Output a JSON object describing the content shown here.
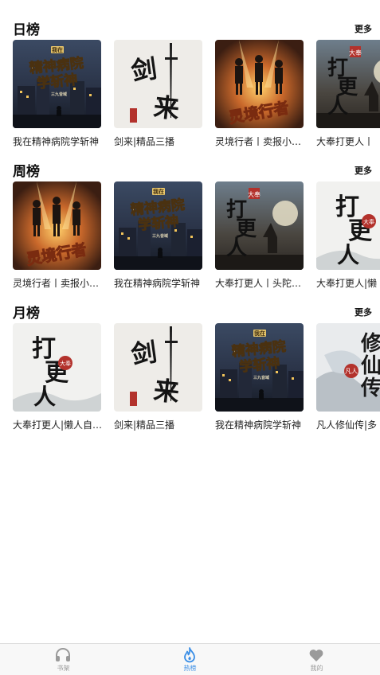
{
  "sections": [
    {
      "title": "日榜",
      "more": "更多",
      "books": [
        {
          "title": "我在精神病院学斩神",
          "cover": "jingshen"
        },
        {
          "title": "剑来|精品三播",
          "cover": "jianlai"
        },
        {
          "title": "灵境行者丨卖报小…",
          "cover": "lingjing"
        },
        {
          "title": "大奉打更人丨",
          "cover": "dafeng-dark"
        }
      ]
    },
    {
      "title": "周榜",
      "more": "更多",
      "books": [
        {
          "title": "灵境行者丨卖报小…",
          "cover": "lingjing"
        },
        {
          "title": "我在精神病院学斩神",
          "cover": "jingshen"
        },
        {
          "title": "大奉打更人丨头陀…",
          "cover": "dafeng-dark"
        },
        {
          "title": "大奉打更人|懒",
          "cover": "dafeng-light"
        }
      ]
    },
    {
      "title": "月榜",
      "more": "更多",
      "books": [
        {
          "title": "大奉打更人|懒人自…",
          "cover": "dafeng-light"
        },
        {
          "title": "剑来|精品三播",
          "cover": "jianlai"
        },
        {
          "title": "我在精神病院学斩神",
          "cover": "jingshen"
        },
        {
          "title": "凡人修仙传|多",
          "cover": "fanren"
        }
      ]
    }
  ],
  "tabbar": {
    "items": [
      {
        "label": "书架",
        "icon": "headphones-icon",
        "active": false
      },
      {
        "label": "热榜",
        "icon": "flame-icon",
        "active": true
      },
      {
        "label": "我的",
        "icon": "heart-icon",
        "active": false
      }
    ],
    "active_color": "#3a8ee6",
    "inactive_color": "#9a9a9a"
  }
}
